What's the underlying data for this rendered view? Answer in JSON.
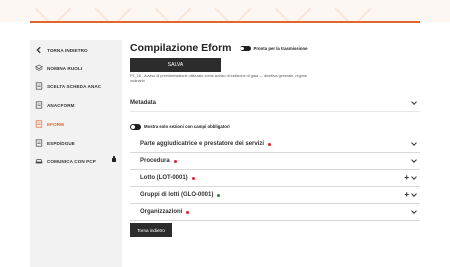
{
  "colors": {
    "accent": "#e0662b",
    "dark_button": "#2c2c2c",
    "dot_red": "#d9262c",
    "dot_green": "#2e8b3a"
  },
  "sidebar": {
    "items": [
      {
        "label": "Torna indietro",
        "icon": "chevron-left-icon"
      },
      {
        "label": "Nomina ruoli",
        "icon": "layers-icon"
      },
      {
        "label": "Scelta scheda ANAC",
        "icon": "document-icon"
      },
      {
        "label": "Anacform",
        "icon": "document-icon"
      },
      {
        "label": "Eform",
        "icon": "document-icon",
        "active": true
      },
      {
        "label": "Espd/DGUE",
        "icon": "document-icon"
      },
      {
        "label": "Comunica con PCP",
        "icon": "car-icon",
        "locked": true
      }
    ]
  },
  "main": {
    "title": "Compilazione Eform",
    "ready_toggle_label": "Pronta per la trasmissione",
    "save_label": "SALVA",
    "note": "P1_16 - Avviso di preinformazione utilizzato come avviso di indizione di gara — direttiva generale, regime ordinario",
    "metadata_label": "Metadata",
    "filter_label": "Mostra solo sezioni con campi obbligatori",
    "sections": [
      {
        "label": "Parte aggiudicatrice e prestatore dei servizi",
        "status": "red",
        "plus": false
      },
      {
        "label": "Procedura",
        "status": "red",
        "plus": false
      },
      {
        "label": "Lotto (LOT-0001)",
        "status": "red",
        "plus": true
      },
      {
        "label": "Gruppi di lotti (GLO-0001)",
        "status": "green",
        "plus": true
      },
      {
        "label": "Organizzazioni",
        "status": "red",
        "plus": false
      }
    ],
    "back_label": "Torna indietro"
  }
}
